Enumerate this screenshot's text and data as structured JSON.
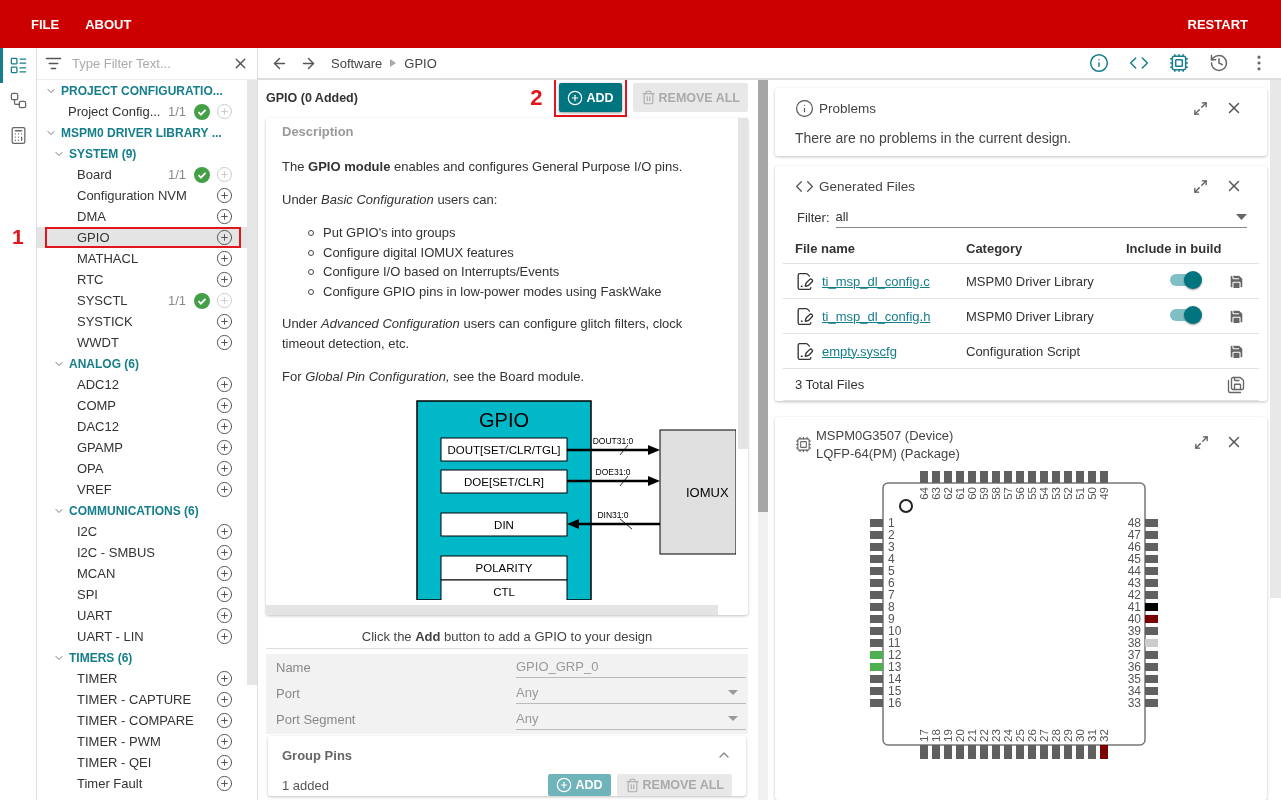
{
  "menu_bar": {
    "items": [
      "FILE",
      "ABOUT"
    ],
    "right": "RESTART"
  },
  "rail": [
    {
      "kind": "list",
      "selected": true
    },
    {
      "kind": "tree",
      "selected": false
    },
    {
      "kind": "calculator",
      "selected": false
    }
  ],
  "sidebar": {
    "filter_placeholder": "Type Filter Text...",
    "tree": [
      {
        "label": "PROJECT CONFIGURATIO...",
        "expanded": true,
        "children": [
          {
            "label": "Project Config...",
            "count": "1/1",
            "added": true,
            "selected": false
          }
        ]
      },
      {
        "label": "MSPM0 DRIVER LIBRARY ...",
        "expanded": true,
        "children": [
          {
            "label": "SYSTEM (9)",
            "expanded": true,
            "children": [
              {
                "label": "Board",
                "count": "1/1",
                "added": true,
                "selected": false
              },
              {
                "label": "Configuration NVM",
                "added": false,
                "selected": false
              },
              {
                "label": "DMA",
                "added": false,
                "selected": false
              },
              {
                "label": "GPIO",
                "added": false,
                "selected": true,
                "annotation": "1"
              },
              {
                "label": "MATHACL",
                "added": false,
                "selected": false
              },
              {
                "label": "RTC",
                "added": false,
                "selected": false
              },
              {
                "label": "SYSCTL",
                "count": "1/1",
                "added": true,
                "selected": false
              },
              {
                "label": "SYSTICK",
                "added": false,
                "selected": false
              },
              {
                "label": "WWDT",
                "added": false,
                "selected": false
              }
            ]
          },
          {
            "label": "ANALOG (6)",
            "expanded": true,
            "children": [
              {
                "label": "ADC12",
                "added": false,
                "selected": false
              },
              {
                "label": "COMP",
                "added": false,
                "selected": false
              },
              {
                "label": "DAC12",
                "added": false,
                "selected": false
              },
              {
                "label": "GPAMP",
                "added": false,
                "selected": false
              },
              {
                "label": "OPA",
                "added": false,
                "selected": false
              },
              {
                "label": "VREF",
                "added": false,
                "selected": false
              }
            ]
          },
          {
            "label": "COMMUNICATIONS (6)",
            "expanded": true,
            "children": [
              {
                "label": "I2C",
                "added": false,
                "selected": false
              },
              {
                "label": "I2C - SMBUS",
                "added": false,
                "selected": false
              },
              {
                "label": "MCAN",
                "added": false,
                "selected": false
              },
              {
                "label": "SPI",
                "added": false,
                "selected": false
              },
              {
                "label": "UART",
                "added": false,
                "selected": false
              },
              {
                "label": "UART - LIN",
                "added": false,
                "selected": false
              }
            ]
          },
          {
            "label": "TIMERS (6)",
            "expanded": true,
            "children": [
              {
                "label": "TIMER",
                "added": false,
                "selected": false
              },
              {
                "label": "TIMER - CAPTURE",
                "added": false,
                "selected": false
              },
              {
                "label": "TIMER - COMPARE",
                "added": false,
                "selected": false
              },
              {
                "label": "TIMER - PWM",
                "added": false,
                "selected": false
              },
              {
                "label": "TIMER - QEI",
                "added": false,
                "selected": false
              },
              {
                "label": "Timer Fault",
                "added": false,
                "selected": false
              }
            ]
          }
        ]
      }
    ]
  },
  "breadcrumb": [
    "Software",
    "GPIO"
  ],
  "toolbar": [
    {
      "kind": "info",
      "on": true
    },
    {
      "kind": "code",
      "on": true
    },
    {
      "kind": "chip",
      "on": true
    },
    {
      "kind": "history",
      "on": false
    },
    {
      "kind": "more",
      "on": false
    }
  ],
  "module": {
    "title": "GPIO (0 Added)",
    "add_button": {
      "label": "ADD",
      "disabled": false,
      "annotation": "2"
    },
    "remove_button": {
      "label": "REMOVE ALL",
      "disabled": true
    },
    "description": {
      "heading": "Description",
      "blocks": [
        {
          "kind": "paragraph",
          "text": "The **GPIO module** enables and configures General Purpose I/O pins."
        },
        {
          "kind": "paragraph",
          "text": "Under *Basic Configuration* users can:"
        },
        {
          "kind": "list",
          "items": [
            "Put GPIO's into groups",
            "Configure digital IOMUX features",
            "Configure I/O based on Interrupts/Events",
            "Configure GPIO pins in low-power modes using FaskWake"
          ]
        },
        {
          "kind": "paragraph",
          "text": "Under *Advanced Configuration* users can configure glitch filters, clock timeout detection, etc."
        },
        {
          "kind": "paragraph",
          "text": "For *Global Pin Configuration,* see the Board module."
        }
      ],
      "diagram": {
        "title": "GPIO",
        "registers": [
          "DOUT[SET/CLR/TGL]",
          "DOE[SET/CLR]",
          "DIN",
          "POLARITY",
          "CTL"
        ],
        "signals": [
          {
            "label": "DOUT31:0",
            "inbound": false
          },
          {
            "label": "DOE31:0",
            "inbound": false
          },
          {
            "label": "DIN31:0",
            "inbound": true
          }
        ],
        "target": "IOMUX"
      }
    },
    "hint": "Click the **Add** button to add a GPIO to your design",
    "fields": [
      {
        "label": "Name",
        "value": "GPIO_GRP_0",
        "kind": "text"
      },
      {
        "label": "Port",
        "value": "Any",
        "kind": "select"
      },
      {
        "label": "Port Segment",
        "value": "Any",
        "kind": "select"
      }
    ],
    "group_pins": {
      "title": "Group Pins",
      "expanded": true,
      "count": "1 added",
      "add_button": {
        "label": "ADD",
        "disabled": true
      },
      "remove_button": {
        "label": "REMOVE ALL",
        "disabled": true
      }
    }
  },
  "problems": {
    "title": "Problems",
    "message": "There are no problems in the current design."
  },
  "generated_files": {
    "title": "Generated Files",
    "filter_label": "Filter:",
    "filter_value": "all",
    "columns": [
      "File name",
      "Category",
      "Include in build"
    ],
    "files": [
      {
        "name": "ti_msp_dl_config.c",
        "category": "MSPM0 Driver Library",
        "include": true
      },
      {
        "name": "ti_msp_dl_config.h",
        "category": "MSPM0 Driver Library",
        "include": true
      },
      {
        "name": "empty.syscfg",
        "category": "Configuration Script"
      }
    ],
    "total": "3 Total Files"
  },
  "device": {
    "device": "MSPM0G3507 (Device)",
    "package": "LQFP-64(PM) (Package)",
    "top_pins": [
      {
        "number": "64",
        "color": "#606060"
      },
      {
        "number": "63",
        "color": "#606060"
      },
      {
        "number": "62",
        "color": "#606060"
      },
      {
        "number": "61",
        "color": "#606060"
      },
      {
        "number": "60",
        "color": "#606060"
      },
      {
        "number": "59",
        "color": "#606060"
      },
      {
        "number": "58",
        "color": "#606060"
      },
      {
        "number": "57",
        "color": "#606060"
      },
      {
        "number": "56",
        "color": "#606060"
      },
      {
        "number": "55",
        "color": "#606060"
      },
      {
        "number": "54",
        "color": "#606060"
      },
      {
        "number": "53",
        "color": "#606060"
      },
      {
        "number": "52",
        "color": "#606060"
      },
      {
        "number": "51",
        "color": "#606060"
      },
      {
        "number": "50",
        "color": "#606060"
      },
      {
        "number": "49",
        "color": "#606060"
      }
    ],
    "left_pins": [
      {
        "number": "1",
        "color": "#606060"
      },
      {
        "number": "2",
        "color": "#606060"
      },
      {
        "number": "3",
        "color": "#606060"
      },
      {
        "number": "4",
        "color": "#606060"
      },
      {
        "number": "5",
        "color": "#606060"
      },
      {
        "number": "6",
        "color": "#606060"
      },
      {
        "number": "7",
        "color": "#606060"
      },
      {
        "number": "8",
        "color": "#606060"
      },
      {
        "number": "9",
        "color": "#606060"
      },
      {
        "number": "10",
        "color": "#606060"
      },
      {
        "number": "11",
        "color": "#606060"
      },
      {
        "number": "12",
        "color": "#4caf50"
      },
      {
        "number": "13",
        "color": "#4caf50"
      },
      {
        "number": "14",
        "color": "#606060"
      },
      {
        "number": "15",
        "color": "#606060"
      },
      {
        "number": "16",
        "color": "#606060"
      }
    ],
    "right_pins": [
      {
        "number": "48",
        "color": "#606060"
      },
      {
        "number": "47",
        "color": "#606060"
      },
      {
        "number": "46",
        "color": "#606060"
      },
      {
        "number": "45",
        "color": "#606060"
      },
      {
        "number": "44",
        "color": "#606060"
      },
      {
        "number": "43",
        "color": "#606060"
      },
      {
        "number": "42",
        "color": "#606060"
      },
      {
        "number": "41",
        "color": "#000000"
      },
      {
        "number": "40",
        "color": "#7b0000"
      },
      {
        "number": "39",
        "color": "#606060"
      },
      {
        "number": "38",
        "color": "#cccccc"
      },
      {
        "number": "37",
        "color": "#606060"
      },
      {
        "number": "36",
        "color": "#606060"
      },
      {
        "number": "35",
        "color": "#606060"
      },
      {
        "number": "34",
        "color": "#606060"
      },
      {
        "number": "33",
        "color": "#606060"
      }
    ],
    "bottom_pins": [
      {
        "number": "17",
        "color": "#606060"
      },
      {
        "number": "18",
        "color": "#606060"
      },
      {
        "number": "19",
        "color": "#606060"
      },
      {
        "number": "20",
        "color": "#606060"
      },
      {
        "number": "21",
        "color": "#606060"
      },
      {
        "number": "22",
        "color": "#606060"
      },
      {
        "number": "23",
        "color": "#606060"
      },
      {
        "number": "24",
        "color": "#606060"
      },
      {
        "number": "25",
        "color": "#606060"
      },
      {
        "number": "26",
        "color": "#606060"
      },
      {
        "number": "27",
        "color": "#606060"
      },
      {
        "number": "28",
        "color": "#606060"
      },
      {
        "number": "29",
        "color": "#606060"
      },
      {
        "number": "30",
        "color": "#606060"
      },
      {
        "number": "31",
        "color": "#606060"
      },
      {
        "number": "32",
        "color": "#7b0000"
      }
    ]
  }
}
